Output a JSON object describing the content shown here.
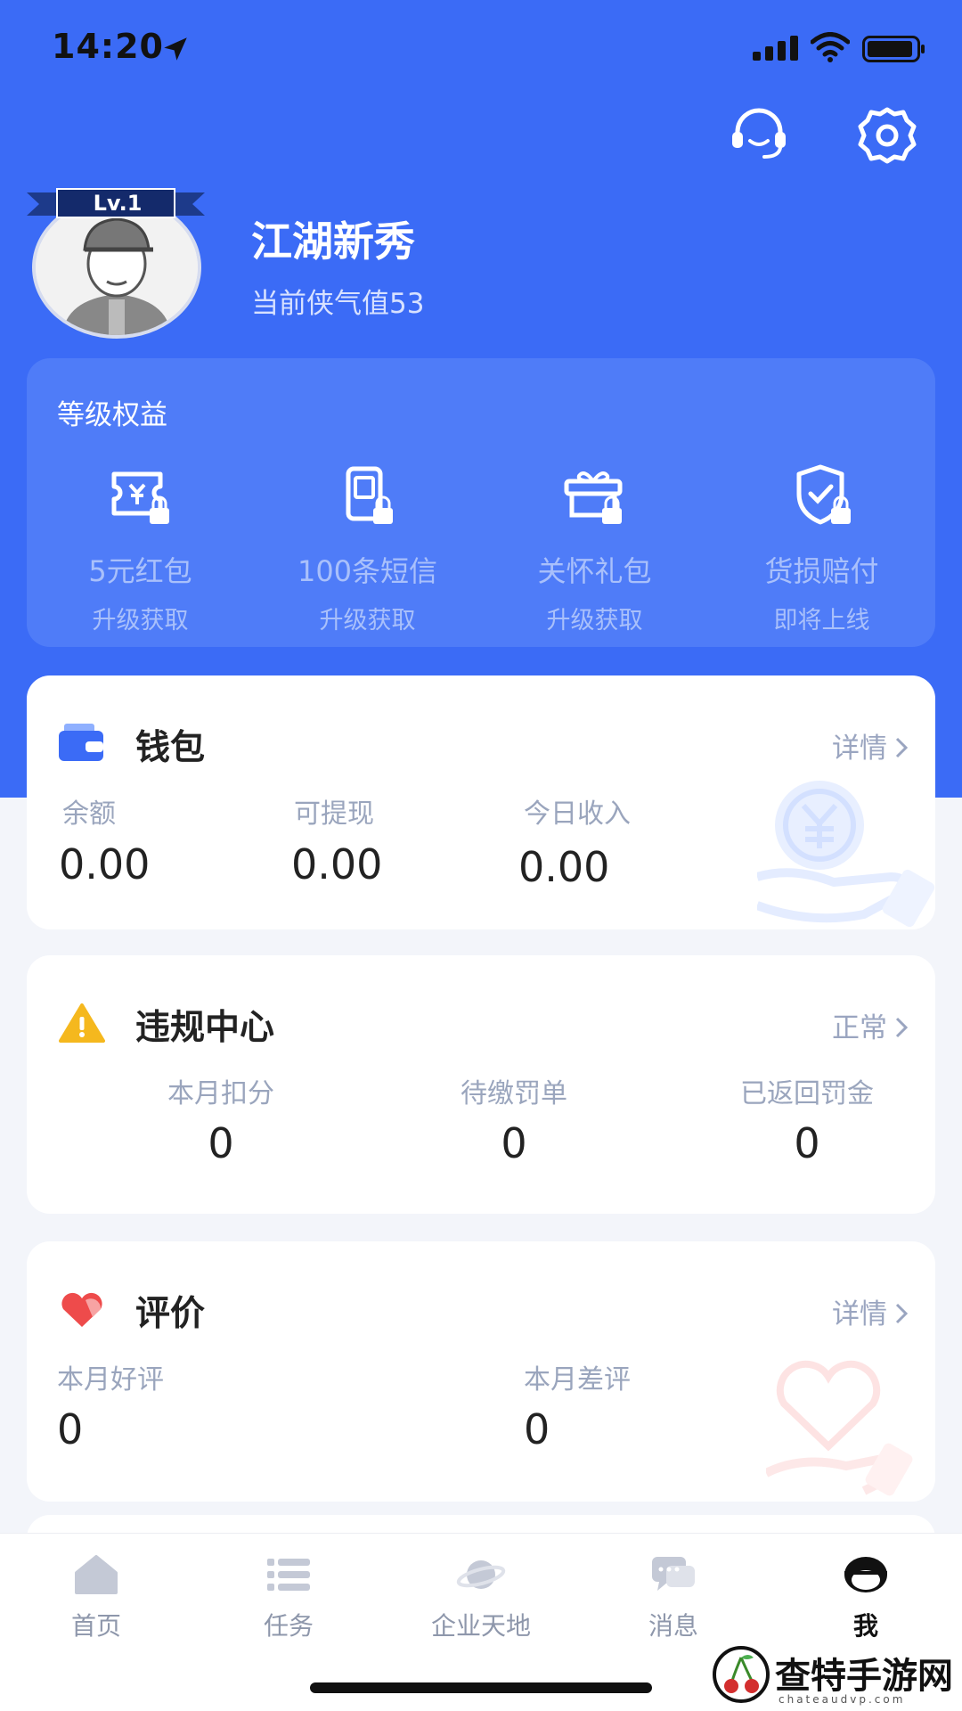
{
  "status_bar": {
    "time": "14:20"
  },
  "profile": {
    "level": "Lv.1",
    "nickname": "江湖新秀",
    "xiaqi": "当前侠气值53"
  },
  "benefits": {
    "title": "等级权益",
    "items": [
      {
        "name": "5元红包",
        "sub": "升级获取",
        "icon": "red-packet-lock-icon"
      },
      {
        "name": "100条短信",
        "sub": "升级获取",
        "icon": "sms-lock-icon"
      },
      {
        "name": "关怀礼包",
        "sub": "升级获取",
        "icon": "gift-lock-icon"
      },
      {
        "name": "货损赔付",
        "sub": "即将上线",
        "icon": "shield-lock-icon"
      }
    ]
  },
  "wallet": {
    "title": "钱包",
    "link": "详情",
    "stats": [
      {
        "label": "余额",
        "value": "0.00"
      },
      {
        "label": "可提现",
        "value": "0.00"
      },
      {
        "label": "今日收入",
        "value": "0.00"
      }
    ]
  },
  "violation": {
    "title": "违规中心",
    "link": "正常",
    "stats": [
      {
        "label": "本月扣分",
        "value": "0"
      },
      {
        "label": "待缴罚单",
        "value": "0"
      },
      {
        "label": "已返回罚金",
        "value": "0"
      }
    ]
  },
  "rating": {
    "title": "评价",
    "link": "详情",
    "stats": [
      {
        "label": "本月好评",
        "value": "0"
      },
      {
        "label": "本月差评",
        "value": "0"
      }
    ]
  },
  "tabs": [
    {
      "label": "首页",
      "icon": "home-icon"
    },
    {
      "label": "任务",
      "icon": "list-icon"
    },
    {
      "label": "企业天地",
      "icon": "planet-icon"
    },
    {
      "label": "消息",
      "icon": "chat-icon"
    },
    {
      "label": "我",
      "icon": "profile-icon",
      "active": true
    }
  ],
  "watermark": {
    "text": "查特手游网",
    "sub": "chateaudvp.com"
  },
  "colors": {
    "primary": "#3b6bf6",
    "benefit_card": "#4f7cf8",
    "warning": "#f5b81e",
    "heart": "#ee4b4b"
  }
}
